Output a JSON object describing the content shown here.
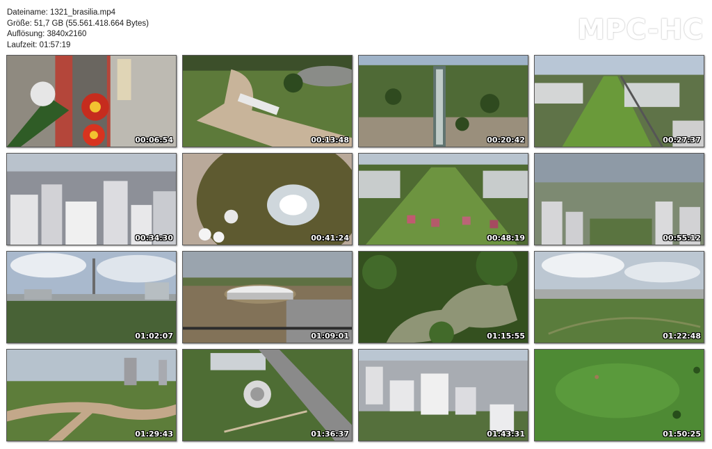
{
  "header": {
    "filename": "Dateiname: 1321_brasilia.mp4",
    "size": "Größe: 51,7 GB (55.561.418.664 Bytes)",
    "resolution": "Auflösung: 3840x2160",
    "duration": "Laufzeit: 01:57:19"
  },
  "logo": "MPC-HC",
  "thumbnails": [
    {
      "time": "00:06:54",
      "scene": "ferris-wheel-top-view"
    },
    {
      "time": "00:13:48",
      "scene": "park-brasilia-letters"
    },
    {
      "time": "00:20:42",
      "scene": "ferris-wheel-city"
    },
    {
      "time": "00:27:37",
      "scene": "esplanada-aerial"
    },
    {
      "time": "00:34:30",
      "scene": "residential-towers"
    },
    {
      "time": "00:41:24",
      "scene": "fountain-top-view"
    },
    {
      "time": "00:48:19",
      "scene": "esplanada-lawn"
    },
    {
      "time": "00:55:12",
      "scene": "skyline-park"
    },
    {
      "time": "01:02:07",
      "scene": "tv-tower"
    },
    {
      "time": "01:09:01",
      "scene": "stadium"
    },
    {
      "time": "01:15:55",
      "scene": "lake-forest"
    },
    {
      "time": "01:22:48",
      "scene": "park-city-horizon"
    },
    {
      "time": "01:29:43",
      "scene": "park-paths"
    },
    {
      "time": "01:36:37",
      "scene": "avenue-park"
    },
    {
      "time": "01:43:31",
      "scene": "dense-city"
    },
    {
      "time": "01:50:25",
      "scene": "green-field"
    }
  ]
}
